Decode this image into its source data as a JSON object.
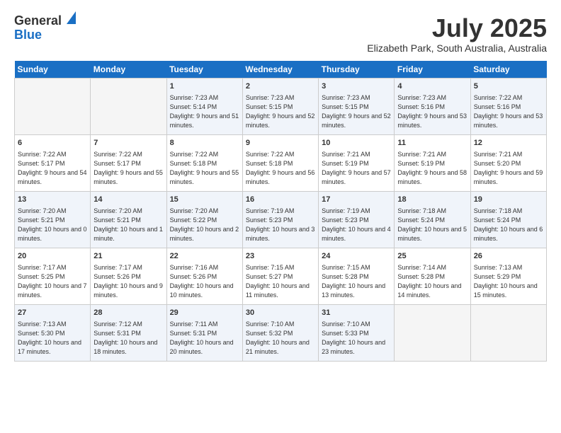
{
  "header": {
    "logo_line1": "General",
    "logo_line2": "Blue",
    "month": "July 2025",
    "location": "Elizabeth Park, South Australia, Australia"
  },
  "weekdays": [
    "Sunday",
    "Monday",
    "Tuesday",
    "Wednesday",
    "Thursday",
    "Friday",
    "Saturday"
  ],
  "weeks": [
    [
      {
        "day": "",
        "empty": true
      },
      {
        "day": "",
        "empty": true
      },
      {
        "day": "1",
        "sunrise": "7:23 AM",
        "sunset": "5:14 PM",
        "daylight": "9 hours and 51 minutes."
      },
      {
        "day": "2",
        "sunrise": "7:23 AM",
        "sunset": "5:15 PM",
        "daylight": "9 hours and 52 minutes."
      },
      {
        "day": "3",
        "sunrise": "7:23 AM",
        "sunset": "5:15 PM",
        "daylight": "9 hours and 52 minutes."
      },
      {
        "day": "4",
        "sunrise": "7:23 AM",
        "sunset": "5:16 PM",
        "daylight": "9 hours and 53 minutes."
      },
      {
        "day": "5",
        "sunrise": "7:22 AM",
        "sunset": "5:16 PM",
        "daylight": "9 hours and 53 minutes."
      }
    ],
    [
      {
        "day": "6",
        "sunrise": "7:22 AM",
        "sunset": "5:17 PM",
        "daylight": "9 hours and 54 minutes."
      },
      {
        "day": "7",
        "sunrise": "7:22 AM",
        "sunset": "5:17 PM",
        "daylight": "9 hours and 55 minutes."
      },
      {
        "day": "8",
        "sunrise": "7:22 AM",
        "sunset": "5:18 PM",
        "daylight": "9 hours and 55 minutes."
      },
      {
        "day": "9",
        "sunrise": "7:22 AM",
        "sunset": "5:18 PM",
        "daylight": "9 hours and 56 minutes."
      },
      {
        "day": "10",
        "sunrise": "7:21 AM",
        "sunset": "5:19 PM",
        "daylight": "9 hours and 57 minutes."
      },
      {
        "day": "11",
        "sunrise": "7:21 AM",
        "sunset": "5:19 PM",
        "daylight": "9 hours and 58 minutes."
      },
      {
        "day": "12",
        "sunrise": "7:21 AM",
        "sunset": "5:20 PM",
        "daylight": "9 hours and 59 minutes."
      }
    ],
    [
      {
        "day": "13",
        "sunrise": "7:20 AM",
        "sunset": "5:21 PM",
        "daylight": "10 hours and 0 minutes."
      },
      {
        "day": "14",
        "sunrise": "7:20 AM",
        "sunset": "5:21 PM",
        "daylight": "10 hours and 1 minute."
      },
      {
        "day": "15",
        "sunrise": "7:20 AM",
        "sunset": "5:22 PM",
        "daylight": "10 hours and 2 minutes."
      },
      {
        "day": "16",
        "sunrise": "7:19 AM",
        "sunset": "5:23 PM",
        "daylight": "10 hours and 3 minutes."
      },
      {
        "day": "17",
        "sunrise": "7:19 AM",
        "sunset": "5:23 PM",
        "daylight": "10 hours and 4 minutes."
      },
      {
        "day": "18",
        "sunrise": "7:18 AM",
        "sunset": "5:24 PM",
        "daylight": "10 hours and 5 minutes."
      },
      {
        "day": "19",
        "sunrise": "7:18 AM",
        "sunset": "5:24 PM",
        "daylight": "10 hours and 6 minutes."
      }
    ],
    [
      {
        "day": "20",
        "sunrise": "7:17 AM",
        "sunset": "5:25 PM",
        "daylight": "10 hours and 7 minutes."
      },
      {
        "day": "21",
        "sunrise": "7:17 AM",
        "sunset": "5:26 PM",
        "daylight": "10 hours and 9 minutes."
      },
      {
        "day": "22",
        "sunrise": "7:16 AM",
        "sunset": "5:26 PM",
        "daylight": "10 hours and 10 minutes."
      },
      {
        "day": "23",
        "sunrise": "7:15 AM",
        "sunset": "5:27 PM",
        "daylight": "10 hours and 11 minutes."
      },
      {
        "day": "24",
        "sunrise": "7:15 AM",
        "sunset": "5:28 PM",
        "daylight": "10 hours and 13 minutes."
      },
      {
        "day": "25",
        "sunrise": "7:14 AM",
        "sunset": "5:28 PM",
        "daylight": "10 hours and 14 minutes."
      },
      {
        "day": "26",
        "sunrise": "7:13 AM",
        "sunset": "5:29 PM",
        "daylight": "10 hours and 15 minutes."
      }
    ],
    [
      {
        "day": "27",
        "sunrise": "7:13 AM",
        "sunset": "5:30 PM",
        "daylight": "10 hours and 17 minutes."
      },
      {
        "day": "28",
        "sunrise": "7:12 AM",
        "sunset": "5:31 PM",
        "daylight": "10 hours and 18 minutes."
      },
      {
        "day": "29",
        "sunrise": "7:11 AM",
        "sunset": "5:31 PM",
        "daylight": "10 hours and 20 minutes."
      },
      {
        "day": "30",
        "sunrise": "7:10 AM",
        "sunset": "5:32 PM",
        "daylight": "10 hours and 21 minutes."
      },
      {
        "day": "31",
        "sunrise": "7:10 AM",
        "sunset": "5:33 PM",
        "daylight": "10 hours and 23 minutes."
      },
      {
        "day": "",
        "empty": true
      },
      {
        "day": "",
        "empty": true
      }
    ]
  ]
}
